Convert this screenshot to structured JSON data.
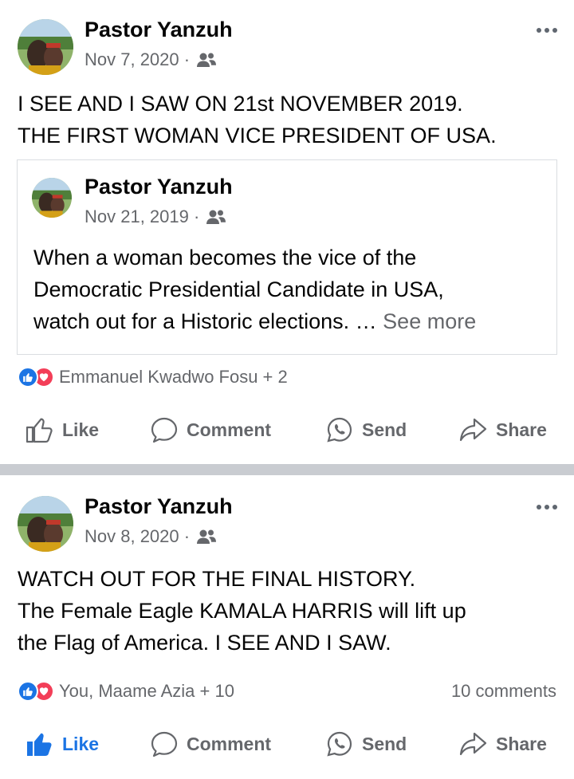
{
  "posts": [
    {
      "author": "Pastor Yanzuh",
      "date": "Nov 7, 2020 ·",
      "audience_icon": "friends-icon",
      "text_lines": [
        "I SEE AND I SAW ON 21st NOVEMBER 2019.",
        "THE FIRST WOMAN VICE PRESIDENT OF USA."
      ],
      "shared": {
        "author": "Pastor Yanzuh",
        "date": "Nov 21, 2019 ·",
        "text_lines": [
          "When a woman becomes the vice of the",
          "Democratic Presidential Candidate in USA,",
          "watch out for a Historic elections. … "
        ],
        "see_more": "See more"
      },
      "reactions": "Emmanuel Kwadwo Fosu + 2",
      "comments": "",
      "actions": {
        "like": "Like",
        "comment": "Comment",
        "send": "Send",
        "share": "Share"
      },
      "liked": false
    },
    {
      "author": "Pastor Yanzuh",
      "date": "Nov 8, 2020 ·",
      "audience_icon": "friends-icon",
      "text_lines": [
        "WATCH OUT FOR THE FINAL HISTORY.",
        "The Female Eagle KAMALA HARRIS will lift up",
        "the Flag of America. I SEE AND I SAW."
      ],
      "reactions": "You, Maame Azia + 10",
      "comments": "10 comments",
      "actions": {
        "like": "Like",
        "comment": "Comment",
        "send": "Send",
        "share": "Share"
      },
      "liked": true
    }
  ],
  "colors": {
    "link_blue": "#1b74e4",
    "love_red": "#f33e58",
    "secondary_text": "#65676b",
    "divider": "#c9ccd1"
  }
}
